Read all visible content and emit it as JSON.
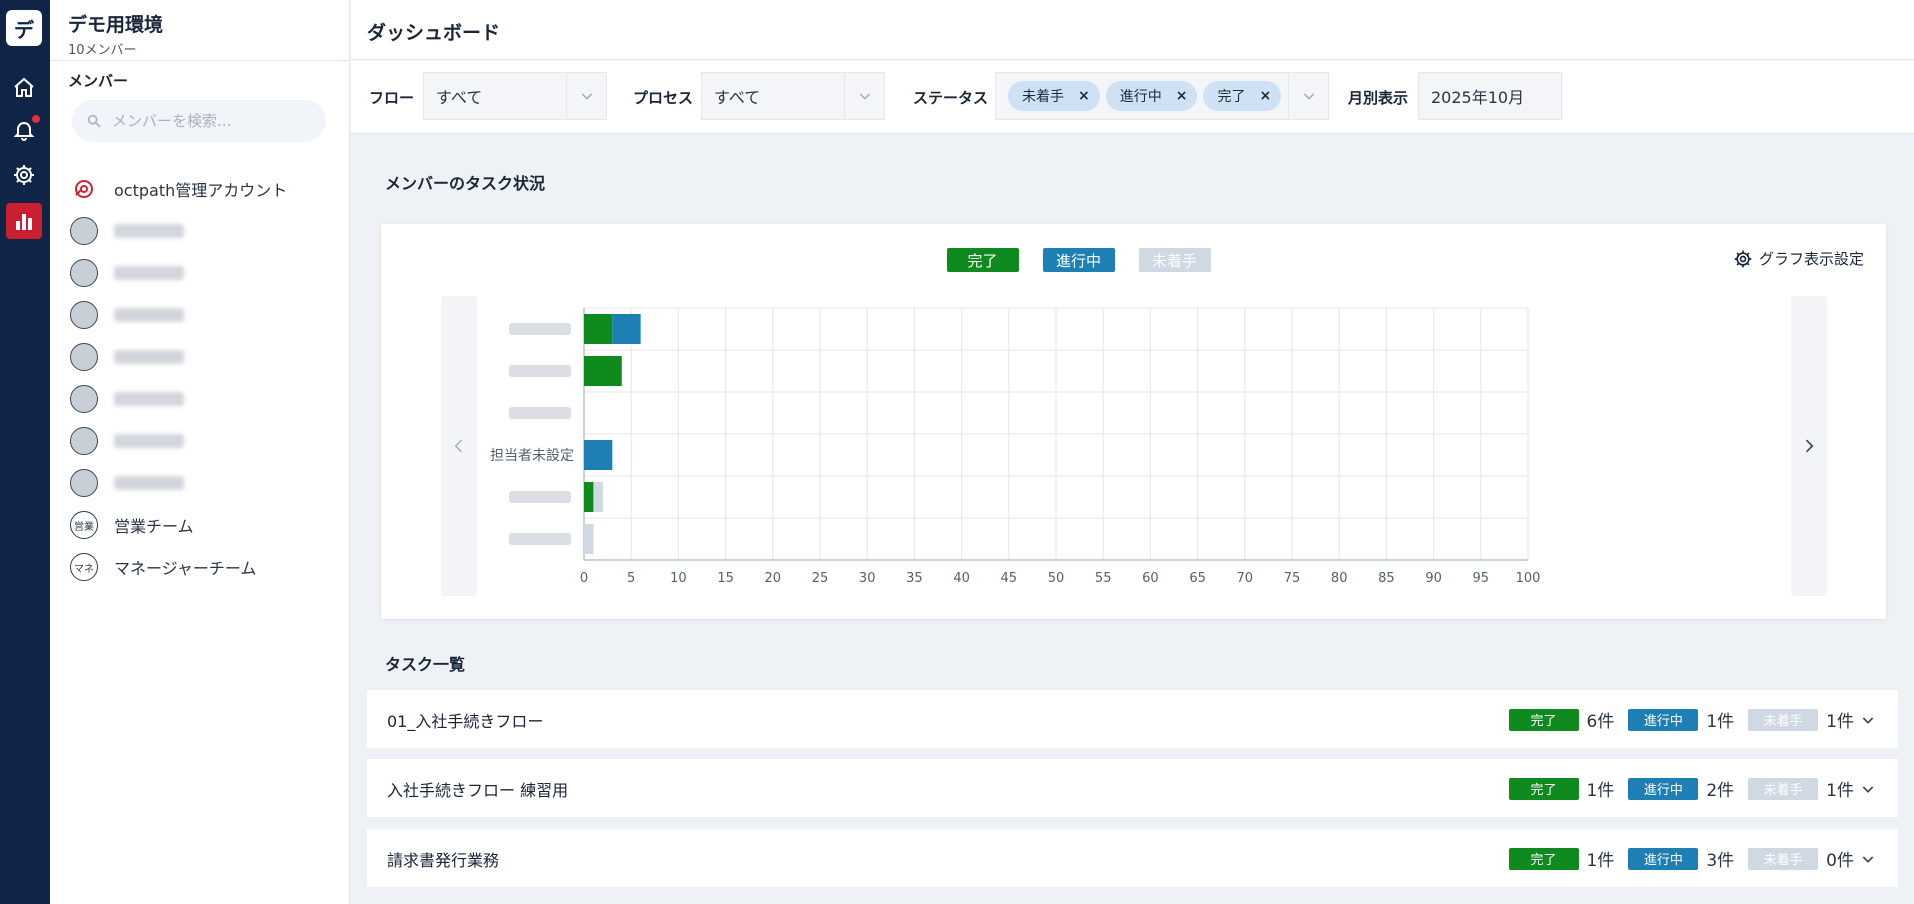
{
  "colors": {
    "done": "#0f8a1f",
    "in_progress": "#1d7fb4",
    "not_started": "#cfd8e3",
    "rail": "#0f2447",
    "accent": "#c8202f"
  },
  "rail": {
    "logo_char": "デ",
    "icons": [
      "home-icon",
      "bell-icon",
      "gear-icon",
      "bar-chart-icon"
    ]
  },
  "sidebar": {
    "workspace_name": "デモ用環境",
    "member_count": "10メンバー",
    "heading": "メンバー",
    "search_placeholder": "メンバーを検索...",
    "members": [
      {
        "label": "octpath管理アカウント",
        "avatar": "",
        "type": "admin"
      },
      {
        "label": "",
        "avatar": "",
        "type": "blurred"
      },
      {
        "label": "",
        "avatar": "",
        "type": "blurred"
      },
      {
        "label": "",
        "avatar": "",
        "type": "blurred"
      },
      {
        "label": "",
        "avatar": "",
        "type": "blurred"
      },
      {
        "label": "",
        "avatar": "",
        "type": "blurred"
      },
      {
        "label": "",
        "avatar": "",
        "type": "blurred"
      },
      {
        "label": "",
        "avatar": "",
        "type": "blurred"
      },
      {
        "label": "営業チーム",
        "avatar": "営業",
        "type": "team"
      },
      {
        "label": "マネージャーチーム",
        "avatar": "マネ",
        "type": "team"
      }
    ]
  },
  "header": {
    "title": "ダッシュボード"
  },
  "filters": {
    "flow_label": "フロー",
    "flow_value": "すべて",
    "process_label": "プロセス",
    "process_value": "すべて",
    "status_label": "ステータス",
    "status_chips": [
      "未着手",
      "進行中",
      "完了"
    ],
    "monthly_label": "月別表示",
    "monthly_value": "2025年10月"
  },
  "chart_section": {
    "heading": "メンバーのタスク状況",
    "legend": [
      "完了",
      "進行中",
      "未着手"
    ],
    "settings_label": "グラフ表示設定"
  },
  "chart_data": {
    "type": "bar",
    "orientation": "horizontal",
    "stacked": true,
    "categories": [
      "",
      "",
      "",
      "担当者未設定",
      "",
      ""
    ],
    "series": [
      {
        "name": "完了",
        "values": [
          3,
          4,
          0,
          0,
          1,
          0
        ]
      },
      {
        "name": "進行中",
        "values": [
          3,
          0,
          0,
          3,
          0,
          0
        ]
      },
      {
        "name": "未着手",
        "values": [
          0,
          0,
          0,
          0,
          1,
          1
        ]
      }
    ],
    "xlim": [
      0,
      100
    ],
    "xticks": [
      0,
      5,
      10,
      15,
      20,
      25,
      30,
      35,
      40,
      45,
      50,
      55,
      60,
      65,
      70,
      75,
      80,
      85,
      90,
      95,
      100
    ],
    "grid": true,
    "legend_position": "top-center"
  },
  "task_section": {
    "heading": "タスク一覧",
    "rows": [
      {
        "name": "01_入社手続きフロー",
        "done": "6件",
        "in_progress": "1件",
        "not_started": "1件"
      },
      {
        "name": "入社手続きフロー 練習用",
        "done": "1件",
        "in_progress": "2件",
        "not_started": "1件"
      },
      {
        "name": "請求書発行業務",
        "done": "1件",
        "in_progress": "3件",
        "not_started": "0件"
      }
    ],
    "badge_done": "完了",
    "badge_in_progress": "進行中",
    "badge_not_started": "未着手"
  }
}
